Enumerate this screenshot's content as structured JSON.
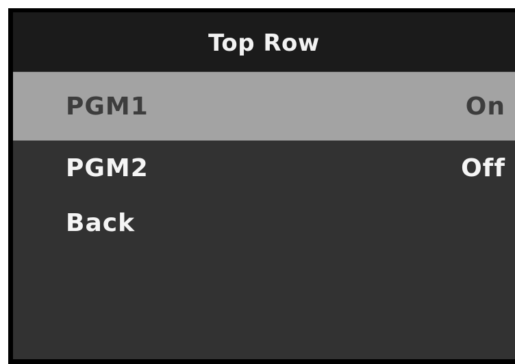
{
  "menu": {
    "title": "Top Row",
    "items": [
      {
        "label": "PGM1",
        "value": "On",
        "selected": true
      },
      {
        "label": "PGM2",
        "value": "Off",
        "selected": false
      },
      {
        "label": "Back",
        "value": "",
        "selected": false
      }
    ]
  },
  "colors": {
    "background": "#323232",
    "titlebar": "#1b1b1b",
    "selected_row": "#a3a3a3",
    "selected_text": "#3d3d3d",
    "text": "#f5f5f5"
  }
}
